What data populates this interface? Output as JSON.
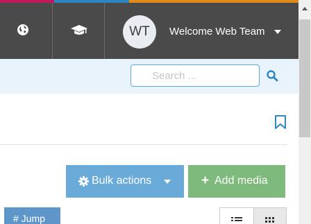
{
  "header": {
    "avatar_initials": "WT",
    "welcome_text": "Welcome Web Team",
    "icons": [
      "globe-icon",
      "graduation-cap-icon",
      "caret-down-icon"
    ]
  },
  "search": {
    "placeholder": "Search ...",
    "icon": "search-icon"
  },
  "toolbar": {
    "bookmark_icon": "bookmark-icon",
    "bulk_actions_label": "Bulk actions",
    "add_media_label": "Add media",
    "jump_label": "# Jump",
    "view_icons": [
      "list-view-icon",
      "grid-view-icon"
    ]
  },
  "colors": {
    "topbar": "#4a4a4a",
    "stripe": [
      "#c2185b",
      "#2e86c1",
      "#e08a1a"
    ],
    "search_strip": "#e8f3fb",
    "bulk_button": "#6aaad9",
    "add_button": "#7dba7b",
    "jump_button": "#5f96c9",
    "accent": "#2e86c1"
  }
}
